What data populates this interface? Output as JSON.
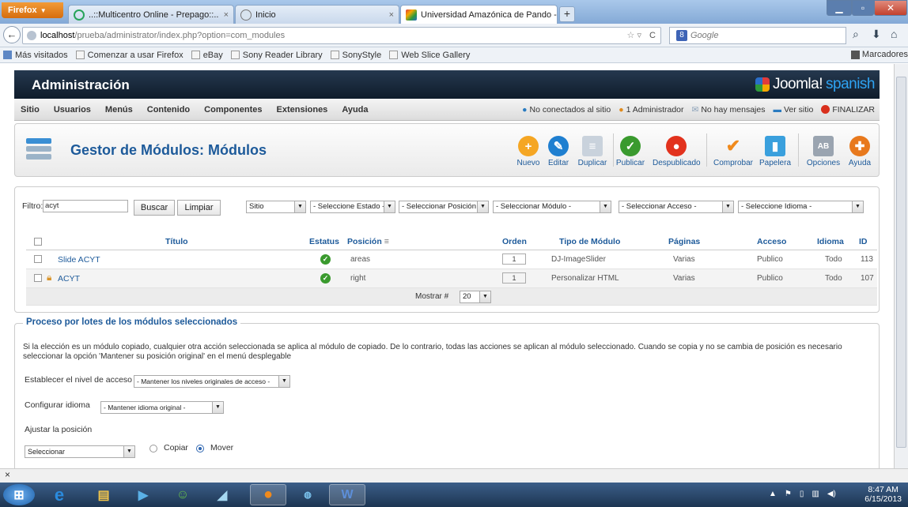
{
  "browser": {
    "menu_label": "Firefox",
    "tabs": [
      {
        "label": "..::Multicentro Online - Prepago::..",
        "active": false
      },
      {
        "label": "Inicio",
        "active": false
      },
      {
        "label": "Universidad Amazónica de Pando - A...",
        "active": true
      }
    ],
    "url_host": "localhost",
    "url_path": "/prueba/administrator/index.php?option=com_modules",
    "search_placeholder": "Google",
    "bookmarks": [
      "Más visitados",
      "Comenzar a usar Firefox",
      "eBay",
      "Sony Reader Library",
      "SonyStyle",
      "Web Slice Gallery"
    ],
    "bookmarks_folder": "Marcadores"
  },
  "admin": {
    "title": "Administración",
    "logo_text": "Joomla!",
    "logo_suffix": "spanish",
    "menu": [
      "Sitio",
      "Usuarios",
      "Menús",
      "Contenido",
      "Componentes",
      "Extensiones",
      "Ayuda"
    ],
    "status": {
      "not_connected": "No conectados al sitio",
      "admin_count": "1 Administrador",
      "messages": "No hay mensajes",
      "view_site": "Ver sitio",
      "logout": "FINALIZAR"
    }
  },
  "toolbar": {
    "page_title": "Gestor de Módulos: Módulos",
    "buttons": [
      {
        "label": "Nuevo",
        "icon": "plus-icon",
        "color": "#f5a623"
      },
      {
        "label": "Editar",
        "icon": "pencil-icon",
        "color": "#1f7fd0"
      },
      {
        "label": "Duplicar",
        "icon": "copy-icon",
        "color": "#c9d2dc"
      },
      {
        "label": "Publicar",
        "icon": "check-icon",
        "color": "#3a9a2e"
      },
      {
        "label": "Despublicado",
        "icon": "stop-icon",
        "color": "#e2321d"
      },
      {
        "label": "Comprobar",
        "icon": "checkmark-icon",
        "color": "#f08a1c"
      },
      {
        "label": "Papelera",
        "icon": "trash-icon",
        "color": "#3aa0dd"
      },
      {
        "label": "Opciones",
        "icon": "options-icon",
        "color": "#9aa4b0"
      },
      {
        "label": "Ayuda",
        "icon": "help-icon",
        "color": "#e8791d"
      }
    ]
  },
  "filter": {
    "label": "Filtro:",
    "value": "acyt",
    "search_button": "Buscar",
    "clear_button": "Limpiar",
    "selects": [
      "Sitio",
      "- Seleccione Estado -",
      "- Seleccionar Posición -",
      "- Seleccionar Módulo -",
      "- Seleccionar Acceso -",
      "- Seleccione Idioma -"
    ]
  },
  "table": {
    "columns": [
      "Título",
      "Estatus",
      "Posición",
      "Orden",
      "Tipo de Módulo",
      "Páginas",
      "Acceso",
      "Idioma",
      "ID"
    ],
    "rows": [
      {
        "title": "Slide ACYT",
        "locked": false,
        "position": "areas",
        "order": "1",
        "type": "DJ-ImageSlider",
        "pages": "Varias",
        "access": "Publico",
        "language": "Todo",
        "id": "113"
      },
      {
        "title": "ACYT",
        "locked": true,
        "position": "right",
        "order": "1",
        "type": "Personalizar HTML",
        "pages": "Varias",
        "access": "Publico",
        "language": "Todo",
        "id": "107"
      }
    ],
    "show_label": "Mostrar #",
    "show_value": "20"
  },
  "batch": {
    "legend": "Proceso por lotes de los módulos seleccionados",
    "description": "Si la elección es un módulo copiado, cualquier otra acción seleccionada se aplica al módulo de copiado. De lo contrario, todas las acciones se aplican al módulo seleccionado. Cuando se copia y no se cambia de posición es necesario seleccionar la opción 'Mantener su posición original' en el menú desplegable",
    "access_label": "Establecer el nivel de acceso",
    "access_value": "- Mantener los niveles originales de acceso -",
    "language_label": "Configurar idioma",
    "language_value": "- Mantener idioma original -",
    "position_label": "Ajustar la posición",
    "position_value": "Seleccionar",
    "copy_label": "Copiar",
    "move_label": "Mover"
  },
  "taskbar": {
    "time": "8:47 AM",
    "date": "6/15/2013"
  }
}
